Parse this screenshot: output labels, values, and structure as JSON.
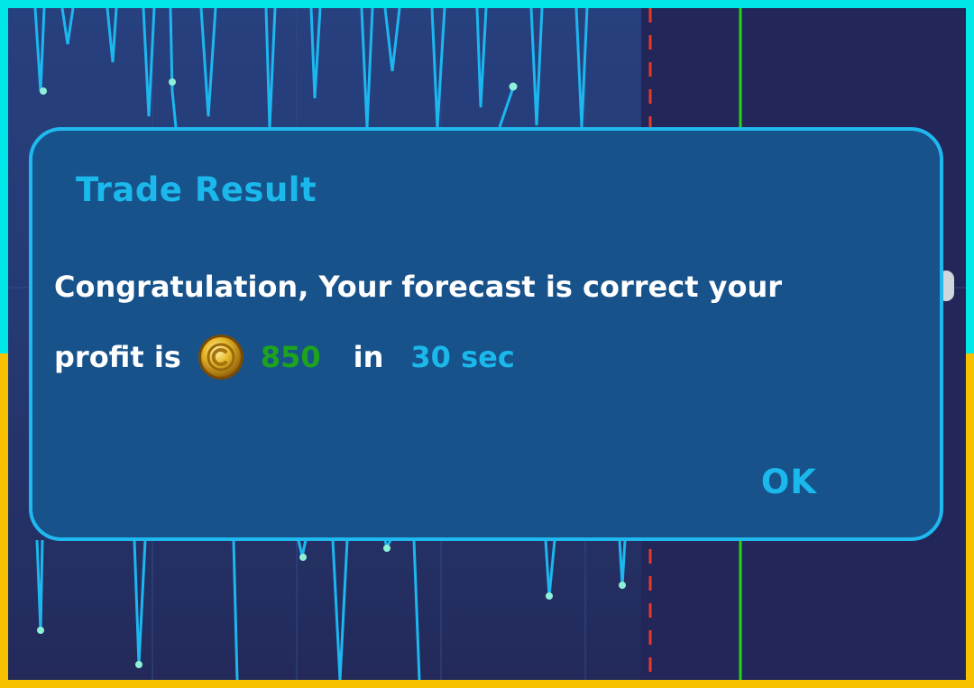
{
  "dialog": {
    "title": "Trade Result",
    "message_line1": "Congratulation, Your forecast is correct your",
    "message_prefix": "profit is",
    "amount": "850",
    "in_label": "in",
    "duration": "30 sec",
    "ok_label": "OK"
  },
  "icons": {
    "coin": "gold-coin-icon"
  },
  "colors": {
    "outer_frame_top": "#00e7e7",
    "outer_frame_bottom": "#f7c100",
    "dialog_background": "#17528a",
    "dialog_border": "#1fb8ef",
    "accent_blue": "#1bb8ec",
    "profit_green": "#1ea31e",
    "chart_line": "#1db7ef",
    "marker_red_dashed": "#e53a2a",
    "marker_green": "#22d61a"
  }
}
